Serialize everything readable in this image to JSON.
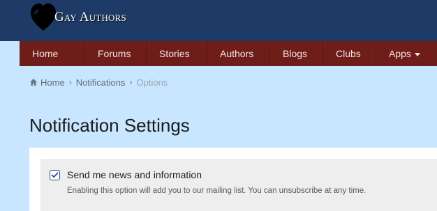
{
  "header": {
    "logo_text": "Gay Authors"
  },
  "nav": {
    "items": [
      {
        "label": "Home"
      },
      {
        "label": "Forums"
      },
      {
        "label": "Stories"
      },
      {
        "label": "Authors"
      },
      {
        "label": "Blogs"
      },
      {
        "label": "Clubs"
      },
      {
        "label": "Apps",
        "icon": "caret-down-icon"
      }
    ]
  },
  "breadcrumb": {
    "items": [
      "Home",
      "Notifications",
      "Options"
    ],
    "icon": "home-icon"
  },
  "page": {
    "title": "Notification Settings"
  },
  "options": [
    {
      "label": "Send me news and information",
      "description": "Enabling this option will add you to our mailing list. You can unsubscribe at any time.",
      "checked": true
    }
  ],
  "colors": {
    "header_bg": "#1e3a66",
    "nav_bg": "#6e1d19",
    "page_bg": "#c8e6ff"
  }
}
